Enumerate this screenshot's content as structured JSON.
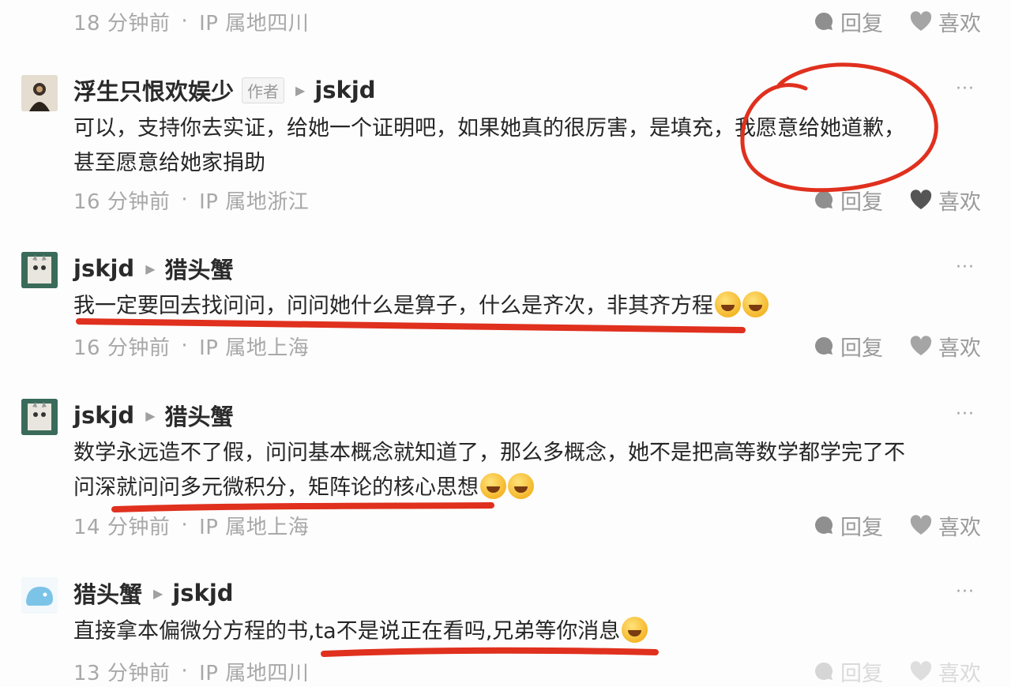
{
  "actions": {
    "reply": "回复",
    "like": "喜欢"
  },
  "more": "···",
  "top_meta": {
    "time": "18 分钟前",
    "ip": "IP 属地四川"
  },
  "comments": [
    {
      "user": "浮生只恨欢娱少",
      "badge": "作者",
      "reply_to": "jskjd",
      "lines": [
        "可以，支持你去实证，给她一个证明吧，如果她真的很厉害，是填充，我愿意给她道歉，",
        "甚至愿意给她家捐助"
      ],
      "time": "16 分钟前",
      "ip": "IP 属地浙江"
    },
    {
      "user": "jskjd",
      "reply_to": "猎头蟹",
      "lines": [
        "我一定要回去找问问，问问她什么是算子，什么是齐次，非其齐方程"
      ],
      "time": "16 分钟前",
      "ip": "IP 属地上海"
    },
    {
      "user": "jskjd",
      "reply_to": "猎头蟹",
      "lines": [
        "数学永远造不了假，问问基本概念就知道了，那么多概念，她不是把高等数学都学完了不",
        "问深就问问多元微积分，矩阵论的核心思想"
      ],
      "time": "14 分钟前",
      "ip": "IP 属地上海"
    },
    {
      "user": "猎头蟹",
      "reply_to": "jskjd",
      "lines": [
        "直接拿本偏微分方程的书,ta不是说正在看吗,兄弟等你消息"
      ],
      "time": "13 分钟前",
      "ip": "IP 属地四川"
    }
  ],
  "colors": {
    "annotation": "#e0301e",
    "meta": "#a8a8a8"
  }
}
